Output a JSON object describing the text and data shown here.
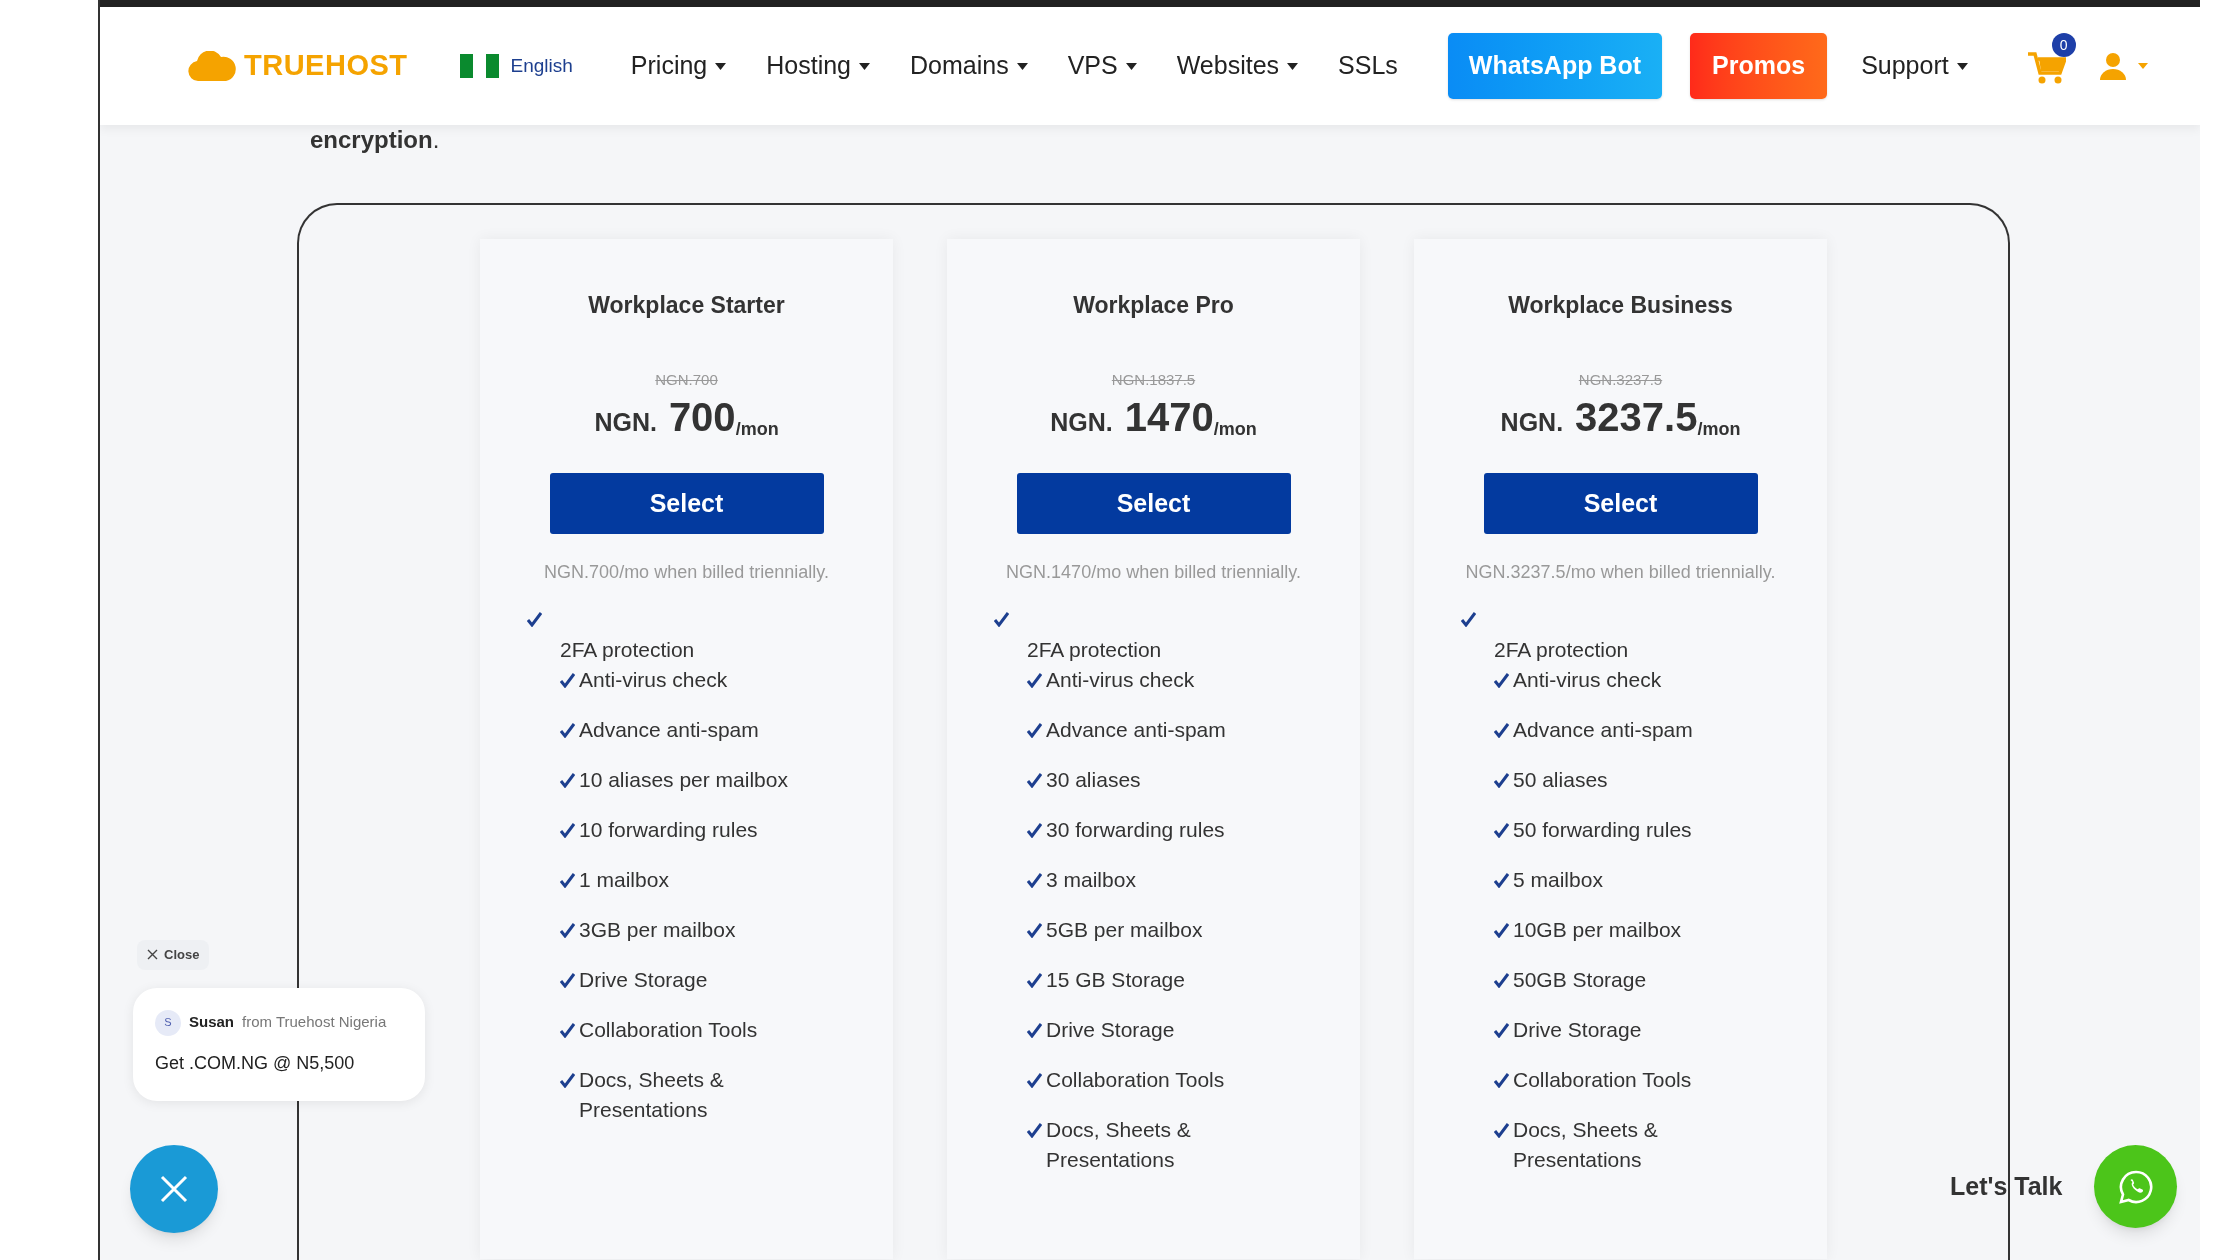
{
  "header": {
    "logo": "TRUEHOST",
    "language": "English",
    "nav": [
      {
        "label": "Pricing",
        "kind": "dropdown"
      },
      {
        "label": "Hosting",
        "kind": "dropdown"
      },
      {
        "label": "Domains",
        "kind": "dropdown"
      },
      {
        "label": "VPS",
        "kind": "dropdown"
      },
      {
        "label": "Websites",
        "kind": "dropdown"
      },
      {
        "label": "SSLs",
        "kind": "link"
      },
      {
        "label": "WhatsApp Bot",
        "kind": "whatsapp"
      },
      {
        "label": "Promos",
        "kind": "promo"
      },
      {
        "label": "Support",
        "kind": "dropdown"
      }
    ],
    "cart_count": "0"
  },
  "intro": "**encryption**.",
  "plans": [
    {
      "name": "Workplace Starter",
      "old_price": "NGN.700",
      "currency": "NGN.",
      "price": "700",
      "period": "/mon",
      "button": "Select",
      "note": "NGN.700/mo when billed triennially.",
      "features": [
        {
          "text": "2FA protection",
          "kind": "broken"
        },
        {
          "text": "Anti-virus check",
          "kind": "inline"
        },
        {
          "text": "Advance anti-spam",
          "kind": "inline"
        },
        {
          "text": "10 aliases per mailbox",
          "kind": "inline"
        },
        {
          "text": "10 forwarding rules",
          "kind": "inline"
        },
        {
          "text": "1 mailbox",
          "kind": "inline"
        },
        {
          "text": "3GB per mailbox",
          "kind": "inline"
        },
        {
          "text": "Drive Storage",
          "kind": "inline"
        },
        {
          "text": "Collaboration Tools",
          "kind": "inline"
        },
        {
          "text": "Docs, Sheets & Presentations",
          "kind": "inline"
        }
      ]
    },
    {
      "name": "Workplace Pro",
      "old_price": "NGN.1837.5",
      "currency": "NGN.",
      "price": "1470",
      "period": "/mon",
      "button": "Select",
      "note": "NGN.1470/mo when billed triennially.",
      "features": [
        {
          "text": "2FA protection",
          "kind": "broken"
        },
        {
          "text": "Anti-virus check",
          "kind": "inline"
        },
        {
          "text": "Advance anti-spam",
          "kind": "inline"
        },
        {
          "text": "30 aliases",
          "kind": "inline"
        },
        {
          "text": "30 forwarding rules",
          "kind": "inline"
        },
        {
          "text": "3 mailbox",
          "kind": "inline"
        },
        {
          "text": "5GB per mailbox",
          "kind": "inline"
        },
        {
          "text": "15 GB Storage",
          "kind": "inline"
        },
        {
          "text": "Drive Storage",
          "kind": "inline"
        },
        {
          "text": "Collaboration Tools",
          "kind": "inline"
        },
        {
          "text": "Docs, Sheets & Presentations",
          "kind": "inline"
        }
      ]
    },
    {
      "name": "Workplace Business",
      "old_price": "NGN.3237.5",
      "currency": "NGN.",
      "price": "3237.5",
      "period": "/mon",
      "button": "Select",
      "note": "NGN.3237.5/mo when billed triennially.",
      "features": [
        {
          "text": "2FA protection",
          "kind": "broken"
        },
        {
          "text": "Anti-virus check",
          "kind": "inline"
        },
        {
          "text": "Advance anti-spam",
          "kind": "inline"
        },
        {
          "text": "50 aliases",
          "kind": "inline"
        },
        {
          "text": "50 forwarding rules",
          "kind": "inline"
        },
        {
          "text": "5 mailbox",
          "kind": "inline"
        },
        {
          "text": "10GB per mailbox",
          "kind": "inline"
        },
        {
          "text": "50GB Storage",
          "kind": "inline"
        },
        {
          "text": "Drive Storage",
          "kind": "inline"
        },
        {
          "text": "Collaboration Tools",
          "kind": "inline"
        },
        {
          "text": "Docs, Sheets & Presentations",
          "kind": "inline"
        }
      ]
    }
  ],
  "chat_popup": {
    "close": "Close",
    "avatar": "S",
    "agent": "Susan",
    "from": "from Truehost Nigeria",
    "message": "Get .COM.NG @ N5,500"
  },
  "whatsapp_widget": {
    "label": "Let's Talk"
  }
}
